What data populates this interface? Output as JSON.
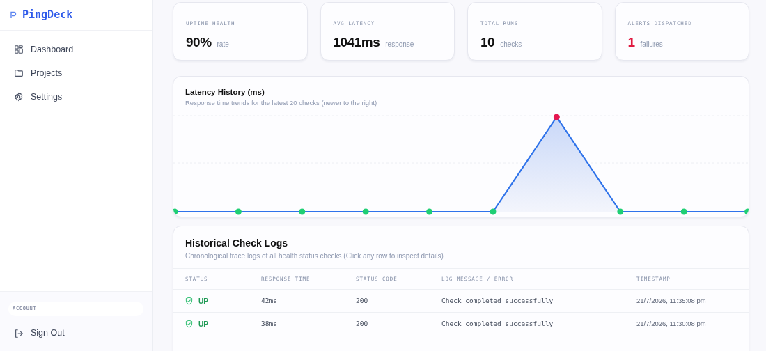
{
  "brand": "PingDeck",
  "nav": [
    {
      "label": "Dashboard",
      "selected": false
    },
    {
      "label": "Projects",
      "selected": false
    },
    {
      "label": "Settings",
      "selected": false
    }
  ],
  "account": {
    "heading": "ACCOUNT",
    "sign_out": "Sign Out"
  },
  "stats": [
    {
      "label": "UPTIME HEALTH",
      "value": "90%",
      "unit": "rate",
      "alert": false
    },
    {
      "label": "AVG LATENCY",
      "value": "1041ms",
      "unit": "response",
      "alert": false
    },
    {
      "label": "TOTAL RUNS",
      "value": "10",
      "unit": "checks",
      "alert": false
    },
    {
      "label": "ALERTS DISPATCHED",
      "value": "1",
      "unit": "failures",
      "alert": true
    }
  ],
  "chart": {
    "title": "Latency History (ms)",
    "subtitle": "Response time trends for the latest 20 checks (newer to the right)"
  },
  "logs": {
    "title": "Historical Check Logs",
    "subtitle": "Chronological trace logs of all health status checks (Click any row to inspect details)",
    "columns": [
      "STATUS",
      "RESPONSE TIME",
      "STATUS CODE",
      "LOG MESSAGE / ERROR",
      "TIMESTAMP"
    ],
    "rows": [
      {
        "status": "UP",
        "up": true,
        "time": "42ms",
        "code": "200",
        "message": "Check completed successfully",
        "timestamp": "21/7/2026, 11:35:08 pm"
      },
      {
        "status": "UP",
        "up": true,
        "time": "38ms",
        "code": "200",
        "message": "Check completed successfully",
        "timestamp": "21/7/2026, 11:30:08 pm"
      }
    ]
  }
}
